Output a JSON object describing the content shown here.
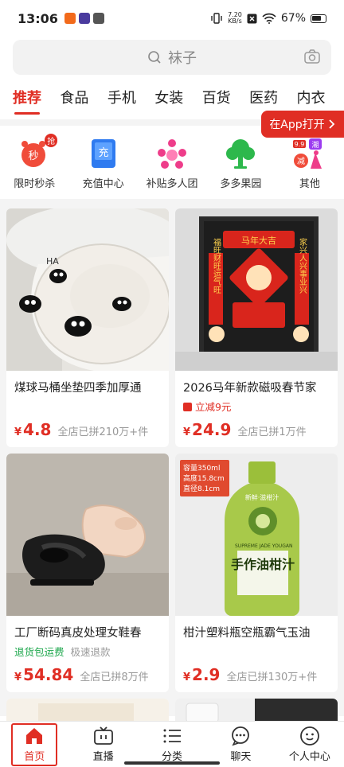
{
  "status": {
    "time": "13:06",
    "speed_top": "7.20",
    "speed_bottom": "KB/s",
    "battery": "67%"
  },
  "search": {
    "placeholder": "袜子"
  },
  "tabs": [
    "推荐",
    "食品",
    "手机",
    "女装",
    "百货",
    "医药",
    "内衣"
  ],
  "app_banner": "在App打开",
  "quick": [
    {
      "label": "限时秒杀",
      "icon": "alarm-clock-icon",
      "badge": "抢"
    },
    {
      "label": "充值中心",
      "icon": "recharge-icon",
      "glyph": "充"
    },
    {
      "label": "补贴多人团",
      "icon": "group-buy-icon"
    },
    {
      "label": "多多果园",
      "icon": "orchard-tree-icon"
    },
    {
      "label": "其他",
      "icon": "others-icon",
      "badge1": "9.9",
      "badge2": "潮",
      "badge3": "减"
    }
  ],
  "products": [
    {
      "title": "煤球马桶坐垫四季加厚通",
      "currency": "¥",
      "price": "4.8",
      "sold": "全店已拼210万+件",
      "tag": ""
    },
    {
      "title": "2026马年新款磁吸春节家",
      "currency": "¥",
      "price": "24.9",
      "sold": "全店已拼1万件",
      "tag": "立减9元"
    },
    {
      "title": "工厂断码真皮处理女鞋春",
      "currency": "¥",
      "price": "54.84",
      "sold": "全店已拼8万件",
      "tag_green": "退货包运费",
      "tag_grey": "极速退款"
    },
    {
      "title": "柑汁塑料瓶空瓶霸气玉油",
      "currency": "¥",
      "price": "2.9",
      "sold": "全店已拼130万+件",
      "tag": ""
    }
  ],
  "product_images": {
    "couplet_1": "马年大吉",
    "couplet_left": "福旺财旺运气旺",
    "couplet_right": "家兴人兴事业兴",
    "bottle_info_1": "容量350ml",
    "bottle_info_2": "高度15.8cm",
    "bottle_info_3": "直径8.1cm",
    "bottle_brand": "SUPREME JADE YOUGAN",
    "bottle_name": "手作油柑汁",
    "bottle_fresh": "新鲜·滋柑汁",
    "toilet_text": "HA"
  },
  "nav": [
    {
      "label": "首页",
      "icon": "home-icon"
    },
    {
      "label": "直播",
      "icon": "live-tv-icon"
    },
    {
      "label": "分类",
      "icon": "category-list-icon"
    },
    {
      "label": "聊天",
      "icon": "chat-bubble-icon"
    },
    {
      "label": "个人中心",
      "icon": "profile-icon"
    }
  ],
  "colors": {
    "accent": "#e02e24",
    "green": "#1aa64a"
  }
}
